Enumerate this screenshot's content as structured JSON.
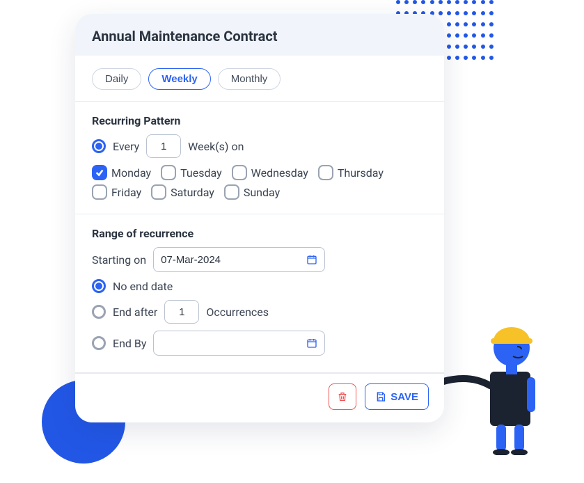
{
  "header": {
    "title": "Annual Maintenance Contract"
  },
  "tabs": {
    "daily": "Daily",
    "weekly": "Weekly",
    "monthly": "Monthly",
    "active": "weekly"
  },
  "pattern": {
    "heading": "Recurring Pattern",
    "every_label": "Every",
    "every_value": "1",
    "weeks_on_label": "Week(s) on",
    "days": [
      {
        "label": "Monday",
        "checked": true
      },
      {
        "label": "Tuesday",
        "checked": false
      },
      {
        "label": "Wednesday",
        "checked": false
      },
      {
        "label": "Thursday",
        "checked": false
      },
      {
        "label": "Friday",
        "checked": false
      },
      {
        "label": "Saturday",
        "checked": false
      },
      {
        "label": "Sunday",
        "checked": false
      }
    ]
  },
  "range": {
    "heading": "Range of recurrence",
    "starting_on_label": "Starting on",
    "start_date": "07-Mar-2024",
    "no_end_label": "No end date",
    "end_after_label": "End after",
    "end_after_value": "1",
    "occurrences_label": "Occurrences",
    "end_by_label": "End By",
    "end_by_value": "",
    "selected": "no_end"
  },
  "footer": {
    "save_label": "SAVE"
  }
}
